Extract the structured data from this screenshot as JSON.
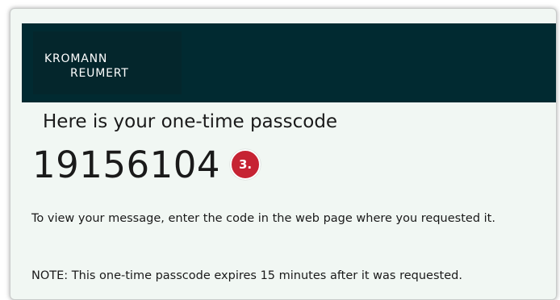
{
  "email": {
    "brand": {
      "line1": "KROMANN",
      "line2": "REUMERT"
    },
    "heading": "Here is your one-time passcode",
    "passcode": "19156104",
    "step_badge": "3.",
    "instructions": "To view your message, enter the code in the web page where you requested it.",
    "note": "NOTE: This one-time passcode expires 15 minutes after it was requested."
  },
  "colors": {
    "banner": "#012a31",
    "background": "#f1f7f3",
    "badge": "#c62333"
  }
}
